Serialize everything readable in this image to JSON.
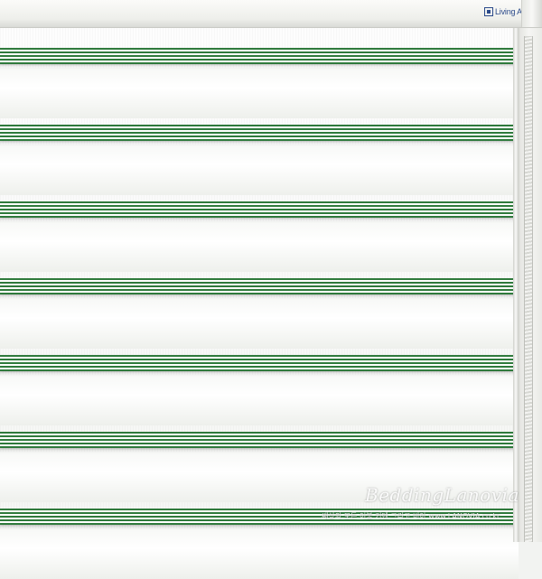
{
  "headrail": {
    "logo_text": "Living Art"
  },
  "fabric": {
    "stripe_color": "#2f7a3c",
    "base_color": "#ffffff",
    "band_count": 7
  },
  "watermark": {
    "brand": "BeddingLanovia",
    "subtitle": "쌔상의 모든 이불 커텐 그리고 비아 www.LANOVIA.co.kr"
  }
}
